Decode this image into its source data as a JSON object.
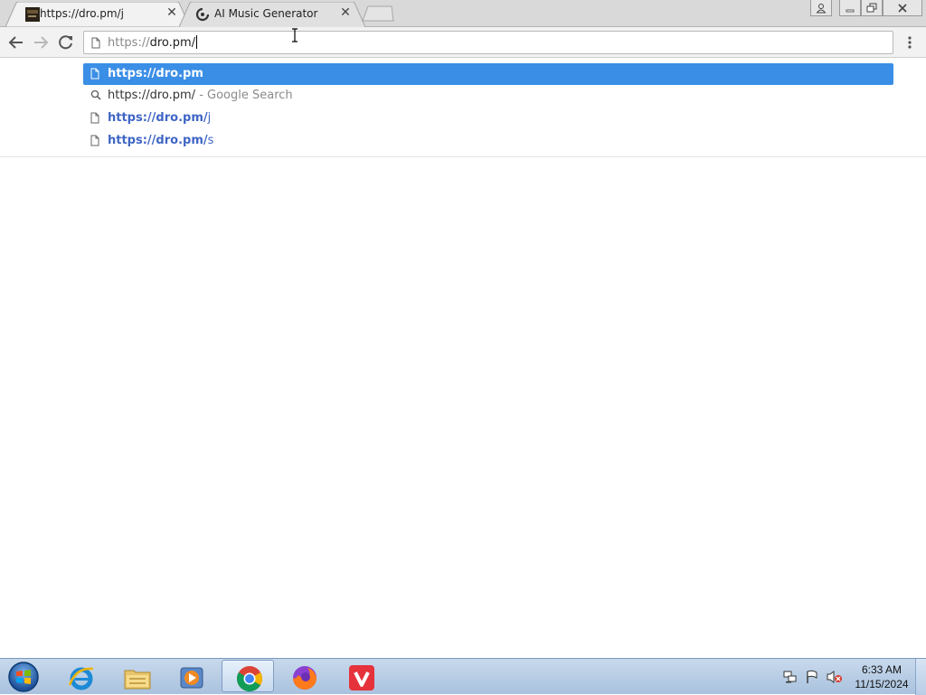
{
  "browser": {
    "tabs": [
      {
        "title": "https://dro.pm/j",
        "active": true,
        "favicon": "dark-thumbnail-icon"
      },
      {
        "title": "AI Music Generator",
        "active": false,
        "favicon": "swirl-logo-icon"
      }
    ],
    "new_tab_icon": "new-tab-icon",
    "window_controls": [
      "profile-icon",
      "minimize-icon",
      "restore-icon",
      "close-icon"
    ]
  },
  "toolbar": {
    "address_bar": {
      "scheme": "https://",
      "host_path": "dro.pm/"
    },
    "icons": [
      "back-arrow-icon",
      "forward-arrow-icon",
      "reload-icon",
      "page-icon",
      "menu-dots-icon"
    ]
  },
  "suggestions": [
    {
      "icon": "page-icon",
      "bold": "https://dro.pm",
      "rest": "",
      "suffix": "",
      "selected": true
    },
    {
      "icon": "search-icon",
      "bold": "",
      "rest": "https://dro.pm/",
      "suffix": "- Google Search",
      "selected": false
    },
    {
      "icon": "page-icon",
      "bold": "https://dro.pm/",
      "rest": "j",
      "suffix": "",
      "selected": false
    },
    {
      "icon": "page-icon",
      "bold": "https://dro.pm/",
      "rest": "s",
      "suffix": "",
      "selected": false
    }
  ],
  "taskbar": {
    "apps": [
      "internet-explorer-icon",
      "file-explorer-icon",
      "media-player-icon",
      "chrome-icon",
      "firefox-icon",
      "vivaldi-icon"
    ],
    "active_app": "chrome-icon",
    "clock": {
      "time": "6:33 AM",
      "date": "11/15/2024"
    }
  }
}
